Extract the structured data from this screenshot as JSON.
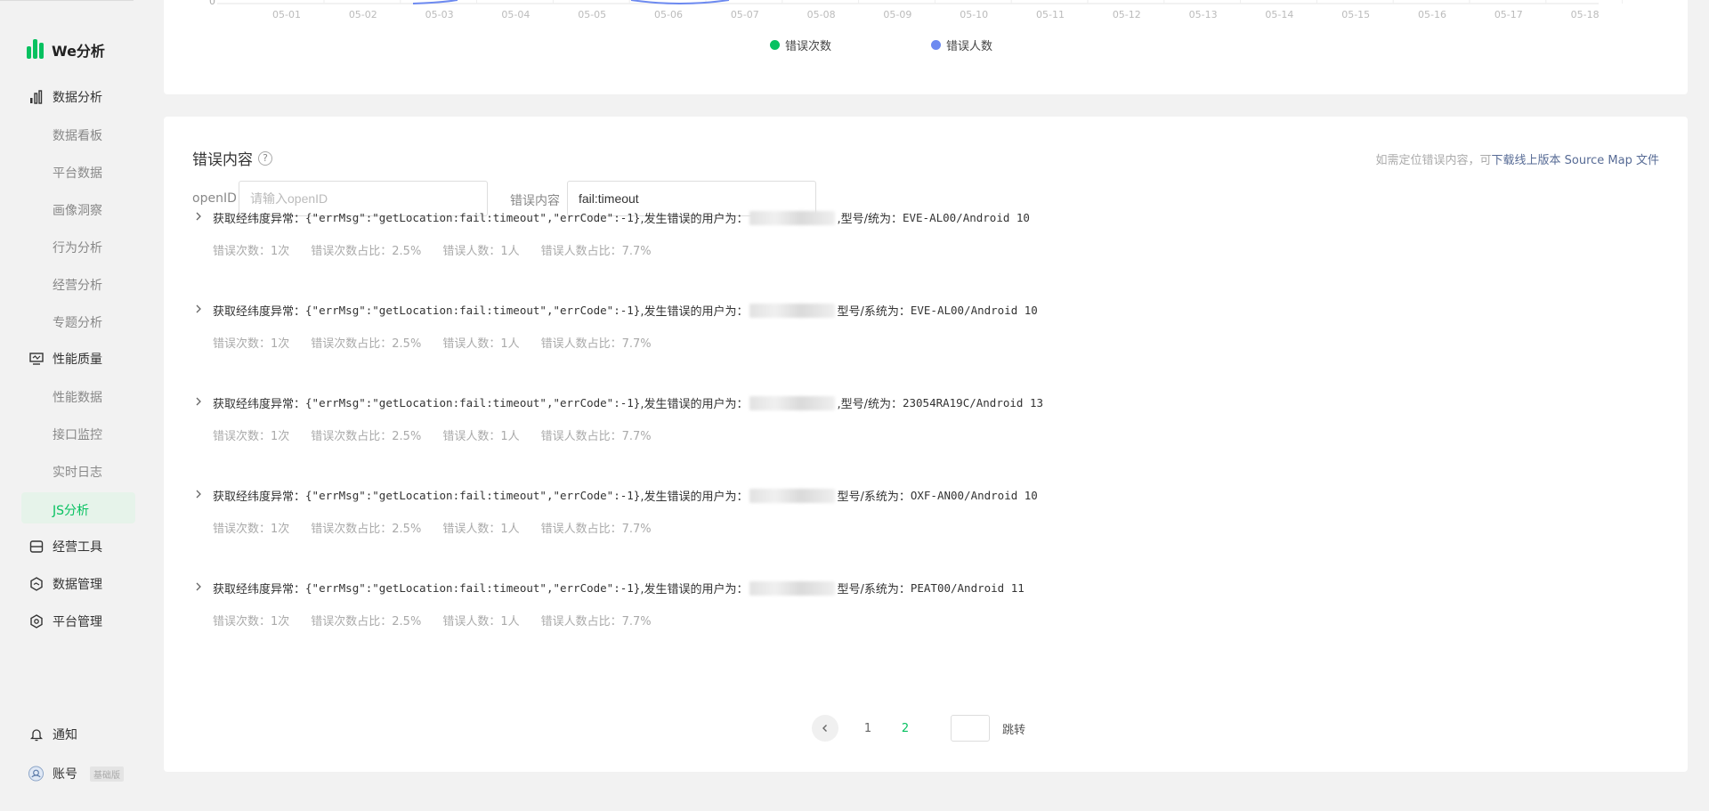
{
  "brand": {
    "title": "We分析"
  },
  "sidebar": {
    "groups": [
      {
        "label": "数据分析",
        "icon": "bar-chart-icon"
      },
      {
        "label": "性能质量",
        "icon": "monitor-icon"
      },
      {
        "label": "经营工具",
        "icon": "drawer-icon"
      },
      {
        "label": "数据管理",
        "icon": "hexagon-check-icon"
      },
      {
        "label": "平台管理",
        "icon": "hexagon-gear-icon"
      }
    ],
    "data_items": [
      "数据看板",
      "平台数据",
      "画像洞察",
      "行为分析",
      "经营分析",
      "专题分析"
    ],
    "perf_items": [
      "性能数据",
      "接口监控",
      "实时日志",
      "JS分析"
    ],
    "notice": "通知",
    "account": "账号",
    "account_badge": "基础版"
  },
  "chart": {
    "x_labels": [
      "05-01",
      "05-02",
      "05-03",
      "05-04",
      "05-05",
      "05-06",
      "05-07",
      "05-08",
      "05-09",
      "05-10",
      "05-11",
      "05-12",
      "05-13",
      "05-14",
      "05-15",
      "05-16",
      "05-17",
      "05-18"
    ],
    "y_zero": "0",
    "legend": [
      {
        "label": "错误次数",
        "color": "#07c160"
      },
      {
        "label": "错误人数",
        "color": "#6d8af0"
      }
    ]
  },
  "errors_section": {
    "title": "错误内容",
    "source_map_prefix": "如需定位错误内容，可",
    "source_map_link": "下载线上版本 Source Map 文件",
    "openid_label": "openID",
    "openid_placeholder": "请输入openID",
    "content_label": "错误内容",
    "content_value": "fail:timeout"
  },
  "errors": [
    {
      "prefix": "获取经纬度异常：",
      "payload": "{\"errMsg\":\"getLocation:fail:timeout\",\"errCode\":-1}",
      "user_label": ",发生错误的用户为：",
      "model_label": ",型号/统为：",
      "model": "EVE-AL00/Android 10",
      "stats": [
        "错误次数：1次",
        "错误次数占比：2.5%",
        "错误人数：1人",
        "错误人数占比：7.7%"
      ]
    },
    {
      "prefix": "获取经纬度异常：",
      "payload": "{\"errMsg\":\"getLocation:fail:timeout\",\"errCode\":-1}",
      "user_label": ",发生错误的用户为：",
      "model_label": "型号/系统为：",
      "model": "EVE-AL00/Android 10",
      "stats": [
        "错误次数：1次",
        "错误次数占比：2.5%",
        "错误人数：1人",
        "错误人数占比：7.7%"
      ]
    },
    {
      "prefix": "获取经纬度异常：",
      "payload": "{\"errMsg\":\"getLocation:fail:timeout\",\"errCode\":-1}",
      "user_label": ",发生错误的用户为：",
      "model_label": ",型号/统为：",
      "model": "23054RA19C/Android 13",
      "stats": [
        "错误次数：1次",
        "错误次数占比：2.5%",
        "错误人数：1人",
        "错误人数占比：7.7%"
      ]
    },
    {
      "prefix": "获取经纬度异常：",
      "payload": "{\"errMsg\":\"getLocation:fail:timeout\",\"errCode\":-1}",
      "user_label": ",发生错误的用户为：",
      "model_label": "型号/系统为：",
      "model": "OXF-AN00/Android 10",
      "stats": [
        "错误次数：1次",
        "错误次数占比：2.5%",
        "错误人数：1人",
        "错误人数占比：7.7%"
      ]
    },
    {
      "prefix": "获取经纬度异常：",
      "payload": "{\"errMsg\":\"getLocation:fail:timeout\",\"errCode\":-1}",
      "user_label": ",发生错误的用户为：",
      "model_label": "型号/系统为：",
      "model": "PEAT00/Android 11",
      "stats": [
        "错误次数：1次",
        "错误次数占比：2.5%",
        "错误人数：1人",
        "错误人数占比：7.7%"
      ]
    }
  ],
  "pagination": {
    "pages": [
      "1",
      "2"
    ],
    "current": "2",
    "jump_label": "跳转"
  }
}
